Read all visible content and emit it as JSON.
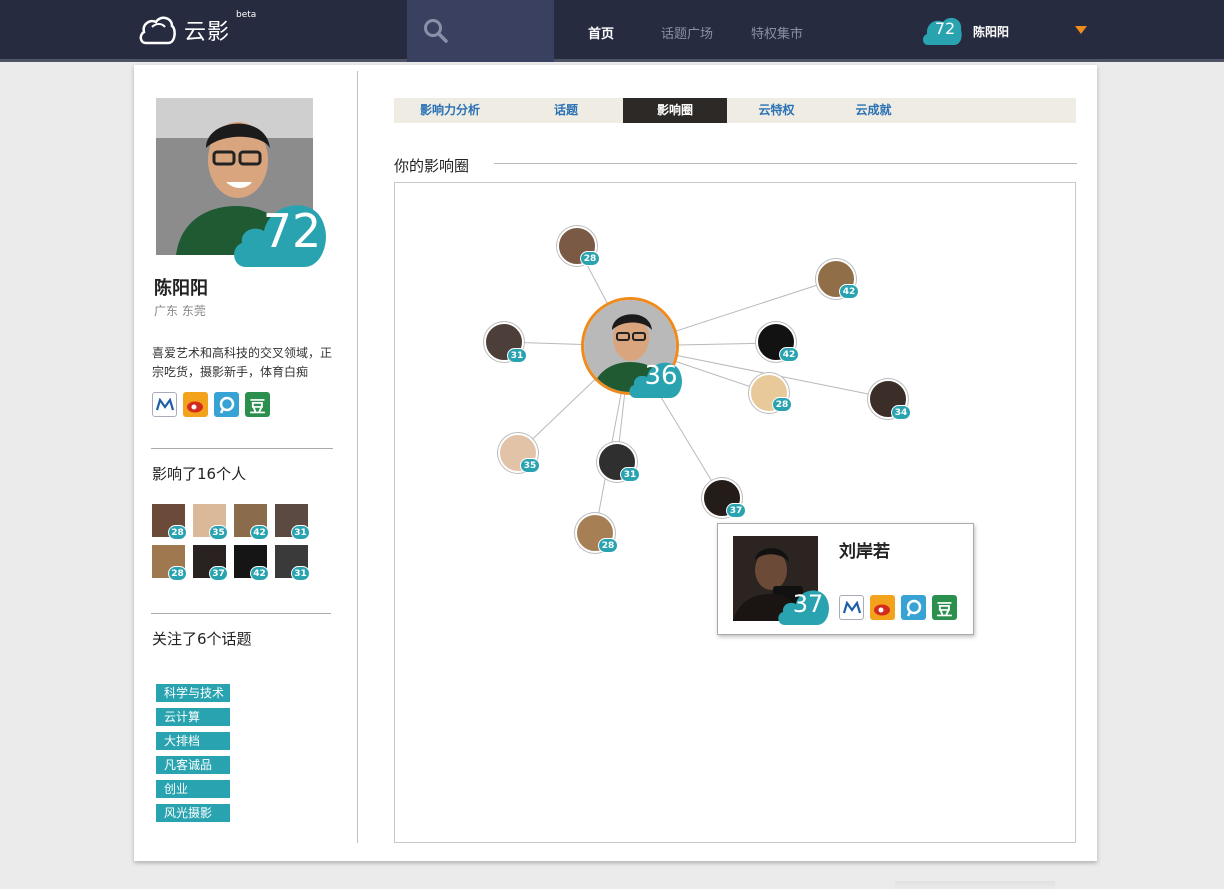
{
  "app": {
    "logo_text": "云影",
    "beta_label": "beta"
  },
  "nav": {
    "home": "首页",
    "topics": "话题广场",
    "market": "特权集市"
  },
  "user": {
    "score": "72",
    "name": "陈阳阳"
  },
  "profile": {
    "name": "陈阳阳",
    "location": "广东 东莞",
    "score": "72",
    "bio": "喜爱艺术和高科技的交叉领域，正宗吃货，摄影新手，体育白痴",
    "douban_char": "豆",
    "influenced_title": "影响了16个人",
    "influenced": [
      {
        "score": "28",
        "color": "#6b4a3a"
      },
      {
        "score": "35",
        "color": "#d9b99a"
      },
      {
        "score": "42",
        "color": "#8a6b4b"
      },
      {
        "score": "31",
        "color": "#5a4a42"
      },
      {
        "score": "28",
        "color": "#a07850"
      },
      {
        "score": "37",
        "color": "#2a2220"
      },
      {
        "score": "42",
        "color": "#151515"
      },
      {
        "score": "31",
        "color": "#3a3a3a"
      }
    ],
    "topics_title": "关注了6个话题",
    "topics": [
      "科学与技术",
      "云计算",
      "大排档",
      "凡客诚品",
      "创业",
      "风光摄影"
    ]
  },
  "tabs": [
    {
      "label": "影响力分析",
      "active": false
    },
    {
      "label": "话题",
      "active": false
    },
    {
      "label": "影响圈",
      "active": true
    },
    {
      "label": "云特权",
      "active": false
    },
    {
      "label": "云成就",
      "active": false
    }
  ],
  "section": {
    "title": "你的影响圈"
  },
  "graph": {
    "center_score": "36",
    "nodes": [
      {
        "score": "28",
        "color": "#7a5a44"
      },
      {
        "score": "42",
        "color": "#8f6e48"
      },
      {
        "score": "31",
        "color": "#4c3e38"
      },
      {
        "score": "42",
        "color": "#121212"
      },
      {
        "score": "28",
        "color": "#e7c99a"
      },
      {
        "score": "34",
        "color": "#3b2e28"
      },
      {
        "score": "35",
        "color": "#e3c3a8"
      },
      {
        "score": "31",
        "color": "#2f2f2f"
      },
      {
        "score": "37",
        "color": "#241c18"
      },
      {
        "score": "28",
        "color": "#a77f55"
      }
    ]
  },
  "popup": {
    "name": "刘岸若",
    "score": "37",
    "douban_char": "豆"
  },
  "colors": {
    "accent_teal": "#2aa3b0",
    "accent_orange": "#f08a1c",
    "topbar": "#262b40"
  }
}
